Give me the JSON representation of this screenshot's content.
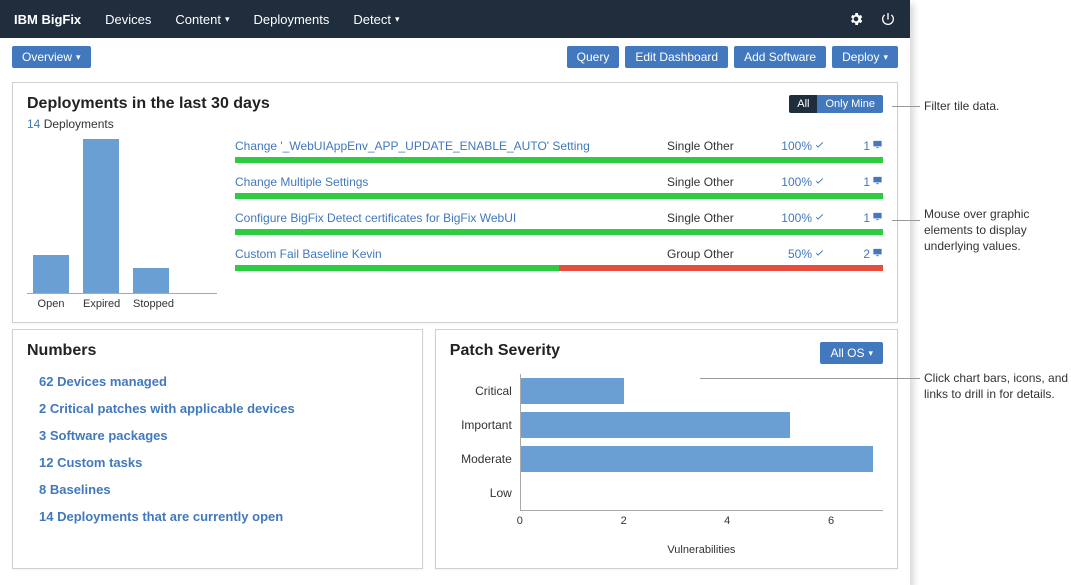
{
  "brand": "IBM BigFix",
  "nav": {
    "devices": "Devices",
    "content": "Content",
    "deployments": "Deployments",
    "detect": "Detect"
  },
  "action_row": {
    "overview": "Overview",
    "query": "Query",
    "edit": "Edit Dashboard",
    "add": "Add Software",
    "deploy": "Deploy"
  },
  "deployments_panel": {
    "title": "Deployments in the last 30 days",
    "sub_count": "14",
    "sub_word": " Deployments",
    "filter_all": "All",
    "filter_mine": "Only Mine",
    "bar_labels": {
      "open": "Open",
      "expired": "Expired",
      "stopped": "Stopped"
    },
    "items": [
      {
        "name": "Change '_WebUIAppEnv_APP_UPDATE_ENABLE_AUTO' Setting",
        "type": "Single Other",
        "pct": "100%",
        "count": "1",
        "fill": 100
      },
      {
        "name": "Change Multiple Settings",
        "type": "Single Other",
        "pct": "100%",
        "count": "1",
        "fill": 100
      },
      {
        "name": "Configure BigFix Detect certificates for BigFix WebUI",
        "type": "Single Other",
        "pct": "100%",
        "count": "1",
        "fill": 100
      },
      {
        "name": "Custom Fail Baseline Kevin",
        "type": "Group Other",
        "pct": "50%",
        "count": "2",
        "fill": 50
      }
    ]
  },
  "numbers_panel": {
    "title": "Numbers",
    "items": [
      "62 Devices managed",
      "2 Critical patches with applicable devices",
      "3 Software packages",
      "12 Custom tasks",
      "8 Baselines",
      "14 Deployments that are currently open"
    ]
  },
  "patch_panel": {
    "title": "Patch Severity",
    "filter": "All OS",
    "xlabel": "Vulnerabilities",
    "ticks": [
      "0",
      "2",
      "4",
      "6"
    ]
  },
  "chart_data": [
    {
      "type": "bar",
      "orientation": "vertical",
      "title": "Deployments in the last 30 days",
      "categories": [
        "Open",
        "Expired",
        "Stopped"
      ],
      "values": [
        3,
        12,
        2
      ],
      "ylabel": "",
      "xlabel": ""
    },
    {
      "type": "bar",
      "orientation": "horizontal",
      "title": "Patch Severity",
      "categories": [
        "Critical",
        "Important",
        "Moderate",
        "Low"
      ],
      "values": [
        2.0,
        5.2,
        6.8,
        0.0
      ],
      "xlabel": "Vulnerabilities",
      "ylabel": "",
      "xlim": [
        0,
        7
      ]
    }
  ],
  "annotations": {
    "filter": "Filter tile data.",
    "hover": "Mouse over graphic elements to display underlying values.",
    "click": "Click chart bars, icons, and links to drill in for details."
  }
}
